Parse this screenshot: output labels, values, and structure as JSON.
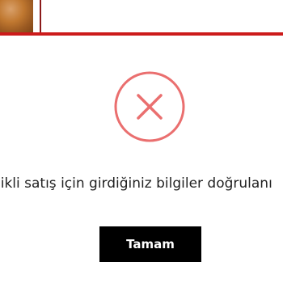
{
  "background": {
    "accent_color": "#cc1b1b"
  },
  "dialog": {
    "icon": "error-x-icon",
    "icon_color": "#ea6f6f",
    "message": "likli satış için girdiğiniz bilgiler doğrulanı",
    "confirm_label": "Tamam"
  }
}
